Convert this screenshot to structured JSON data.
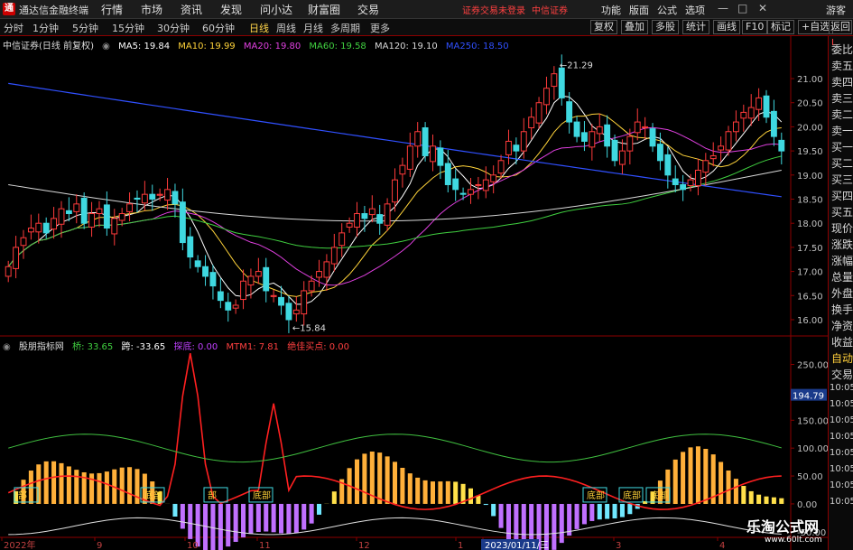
{
  "app": {
    "title": "通达信金融终端",
    "menus": [
      "行情",
      "市场",
      "资讯",
      "发现",
      "问小达",
      "财富圈",
      "交易"
    ],
    "warning1": "证券交易未登录",
    "warning2": "中信证券",
    "right_menus": [
      "功能",
      "版面",
      "公式",
      "选项"
    ],
    "guest": "游客"
  },
  "toolbar": {
    "periods": [
      "分时",
      "1分钟",
      "5分钟",
      "15分钟",
      "30分钟",
      "60分钟",
      "日线",
      "周线",
      "月线",
      "多周期",
      "更多"
    ],
    "active": "日线",
    "right_buttons": [
      "复权",
      "叠加",
      "多股",
      "统计",
      "画线",
      "F10",
      "标记",
      "+自选",
      "返回"
    ]
  },
  "main_legend": {
    "stock": "中信证券(日线 前复权)",
    "ma": [
      {
        "label": "MA5: 19.84",
        "color": "#ffffff"
      },
      {
        "label": "MA10: 19.99",
        "color": "#ffd33a"
      },
      {
        "label": "MA20: 19.80",
        "color": "#e040e0"
      },
      {
        "label": "MA60: 19.58",
        "color": "#40d040"
      },
      {
        "label": "MA120: 19.10",
        "color": "#d8d8d8"
      },
      {
        "label": "MA250: 18.50",
        "color": "#3050ff"
      }
    ]
  },
  "price_axis": {
    "ticks": [
      "21.00",
      "20.50",
      "20.00",
      "19.50",
      "19.00",
      "18.50",
      "18.00",
      "17.50",
      "17.00",
      "16.50",
      "16.00"
    ],
    "min": 15.84,
    "max": 21.29,
    "high_label": "21.29",
    "low_label": "15.84"
  },
  "indicator_legend": {
    "name": "股朋指标网",
    "items": [
      {
        "label": "桥: 33.65",
        "color": "#40d040"
      },
      {
        "label": "跨: -33.65",
        "color": "#ffffff"
      },
      {
        "label": "探底: 0.00",
        "color": "#c040ff"
      },
      {
        "label": "MTM1: 7.81",
        "color": "#ff4040"
      },
      {
        "label": "绝佳买点: 0.00",
        "color": "#ff4040"
      }
    ]
  },
  "indicator_axis": {
    "ticks": [
      "250.00",
      "150.00",
      "100.00",
      "50.00",
      "0.00",
      "-50.00"
    ],
    "current": "194.79",
    "labels": [
      "部",
      "底部",
      "部",
      "底部",
      "底部",
      "底部",
      "底部"
    ]
  },
  "x_axis": {
    "labels": [
      "2022年",
      "9",
      "10",
      "11",
      "12",
      "1",
      "2023/01/11/三",
      "3",
      "4"
    ]
  },
  "right_panel": {
    "order_items": [
      "委比",
      "卖五",
      "卖四",
      "卖三",
      "卖二",
      "卖一",
      "买一",
      "买二",
      "买三",
      "买四",
      "买五",
      "现价",
      "涨跌",
      "涨幅",
      "总量",
      "外盘",
      "换手",
      "净资",
      "收益"
    ],
    "auto_label": "自动",
    "trade_label": "交易",
    "times": [
      "10:05",
      "10:05",
      "10:05",
      "10:05",
      "10:05",
      "10:05",
      "10:05",
      "10:05"
    ]
  },
  "watermark": {
    "name": "乐淘公式网",
    "url": "www.60lt.com"
  },
  "chart_data": {
    "type": "candlestick",
    "title": "中信证券(日线 前复权)",
    "high": 21.29,
    "low": 15.84,
    "ylim": [
      15.7,
      21.6
    ],
    "close_series": [
      17.1,
      17.5,
      17.7,
      17.9,
      18.0,
      17.8,
      18.1,
      18.3,
      18.2,
      18.4,
      18.0,
      18.2,
      18.3,
      17.9,
      18.1,
      18.2,
      18.4,
      18.5,
      18.6,
      18.5,
      18.6,
      18.7,
      18.4,
      17.6,
      17.3,
      17.1,
      16.9,
      16.7,
      16.4,
      16.2,
      16.3,
      16.8,
      16.9,
      17.0,
      16.6,
      16.5,
      16.3,
      16.0,
      16.2,
      16.6,
      16.8,
      17.0,
      17.2,
      17.5,
      17.8,
      18.0,
      18.2,
      18.1,
      18.3,
      18.0,
      18.4,
      18.9,
      19.2,
      19.6,
      19.9,
      19.4,
      19.6,
      19.2,
      18.8,
      18.7,
      18.6,
      18.7,
      18.8,
      18.9,
      19.0,
      19.3,
      19.7,
      19.5,
      19.9,
      20.2,
      20.5,
      20.8,
      21.1,
      20.6,
      20.1,
      19.8,
      19.7,
      19.9,
      20.0,
      19.6,
      19.3,
      19.5,
      19.8,
      20.1,
      20.0,
      19.6,
      19.3,
      19.0,
      18.8,
      18.7,
      18.9,
      19.1,
      19.3,
      19.4,
      19.6,
      19.9,
      20.1,
      20.3,
      20.4,
      20.6,
      20.2,
      19.8,
      19.5
    ],
    "indicator_mtm_peak": 270,
    "indicator_ylim": [
      -60,
      280
    ]
  }
}
